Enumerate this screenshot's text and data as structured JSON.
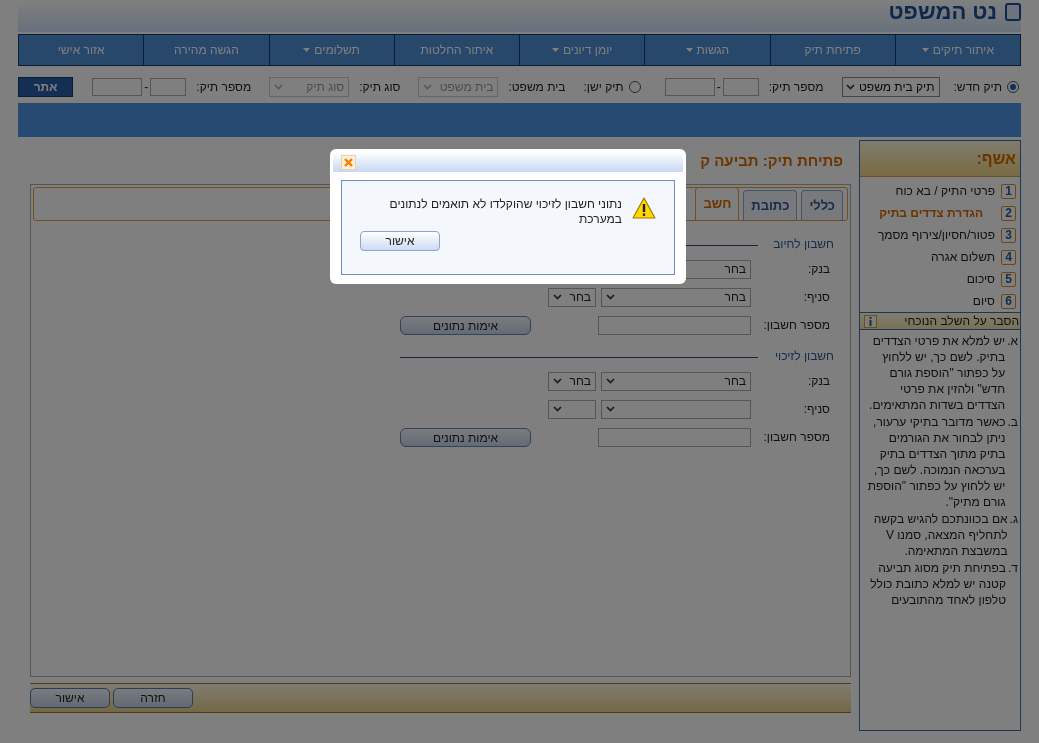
{
  "header": {
    "title": "נט המשפט"
  },
  "nav": [
    {
      "label": "איתור תיקים",
      "dropdown": true
    },
    {
      "label": "פתיחת תיק",
      "dropdown": false
    },
    {
      "label": "הגשות",
      "dropdown": true
    },
    {
      "label": "יומן דיונים",
      "dropdown": true
    },
    {
      "label": "איתור החלטות",
      "dropdown": false
    },
    {
      "label": "תשלומים",
      "dropdown": true
    },
    {
      "label": "הגשה מהירה",
      "dropdown": false
    },
    {
      "label": "אזור אישי",
      "dropdown": false
    }
  ],
  "search_bar": [
    {
      "kind": "radio",
      "label": "תיק חדש:",
      "selected": true
    },
    {
      "kind": "select",
      "value": "תיק בית משפט",
      "disabled": false
    },
    {
      "kind": "label",
      "text": "מספר תיק:"
    },
    {
      "kind": "input"
    },
    {
      "kind": "sep",
      "text": "-"
    },
    {
      "kind": "input"
    },
    {
      "kind": "radio",
      "label": "תיק ישן:",
      "selected": false
    },
    {
      "kind": "label",
      "text": "בית משפט:"
    },
    {
      "kind": "select",
      "placeholder": "בית משפט",
      "disabled": true
    },
    {
      "kind": "label",
      "text": "סוג תיק:"
    },
    {
      "kind": "select",
      "placeholder": "סוג תיק",
      "disabled": true
    },
    {
      "kind": "label",
      "text": "מספר תיק:"
    },
    {
      "kind": "input"
    },
    {
      "kind": "sep",
      "text": "-"
    },
    {
      "kind": "input"
    },
    {
      "kind": "button",
      "text": "אתר"
    }
  ],
  "main": {
    "title": "פתיחת תיק: תביעה ק",
    "tabs": [
      {
        "label": "כללי",
        "selected": false
      },
      {
        "label": "כתובת",
        "selected": false
      },
      {
        "label": "חשב",
        "selected": true
      }
    ],
    "sections": [
      {
        "legend": "חשבון לחיוב",
        "rows": [
          {
            "label": "בנק:",
            "fields": [
              {
                "kind": "select",
                "value": "בחר"
              }
            ]
          },
          {
            "label": "סניף:",
            "fields": [
              {
                "kind": "select",
                "value": "בחר"
              },
              {
                "kind": "small_select",
                "value": "בחר"
              }
            ]
          },
          {
            "label": "מספר חשבון:",
            "fields": [
              {
                "kind": "input"
              },
              {
                "kind": "button",
                "value": "אימות נתונים"
              }
            ]
          }
        ]
      },
      {
        "legend": "חשבון לזיכוי",
        "rows": [
          {
            "label": "בנק:",
            "fields": [
              {
                "kind": "select",
                "value": "בחר"
              },
              {
                "kind": "small_select",
                "value": "בחר"
              }
            ]
          },
          {
            "label": "סניף:",
            "fields": [
              {
                "kind": "select"
              },
              {
                "kind": "small_select"
              }
            ]
          },
          {
            "label": "מספר חשבון:",
            "fields": [
              {
                "kind": "input"
              },
              {
                "kind": "button",
                "value": "אימות נתונים"
              }
            ]
          }
        ]
      }
    ],
    "footer_buttons": [
      "חזרה",
      "אישור"
    ]
  },
  "wizard": {
    "title": "אשף:",
    "steps": [
      {
        "number": "1",
        "label": "פרטי התיק / בא כוח",
        "selected": false
      },
      {
        "number": "2",
        "label": "הגדרת צדדים בתיק",
        "selected": true
      },
      {
        "number": "3",
        "label": "פטור/חסיון/צירוף מסמך",
        "selected": false
      },
      {
        "number": "4",
        "label": "תשלום אגרה",
        "selected": false
      },
      {
        "number": "5",
        "label": "סיכום",
        "selected": false
      },
      {
        "number": "6",
        "label": "סיום",
        "selected": false
      }
    ],
    "help_title": "הסבר על השלב הנוכחי",
    "help_items": [
      {
        "marker": "א.",
        "text": "יש למלא את פרטי הצדדים בתיק. לשם כך, יש ללחוץ על כפתור \"הוספת גורם חדש\" ולהזין את פרטי הצדדים בשדות המתאימים."
      },
      {
        "marker": "ב.",
        "text": "כאשר מדובר בתיקי ערעור, ניתן לבחור את הגורמים בתיק מתוך הצדדים בתיק בערכאה הנמוכה. לשם כך, יש ללחוץ על כפתור \"הוספת גורם מתיק\"."
      },
      {
        "marker": "ג.",
        "text": "אם בכוונתכם להגיש בקשה לתחליף המצאה, סמנו V במשבצת המתאימה."
      },
      {
        "marker": "ד.",
        "text": "בפתיחת תיק מסוג תביעה קטנה יש למלא כתובת כולל טלפון לאחד מהתובעים"
      }
    ]
  },
  "dialog": {
    "message": "נתוני חשבון לזיכוי שהוקלדו לא תואמים לנתונים במערכת",
    "button": "אישור"
  }
}
